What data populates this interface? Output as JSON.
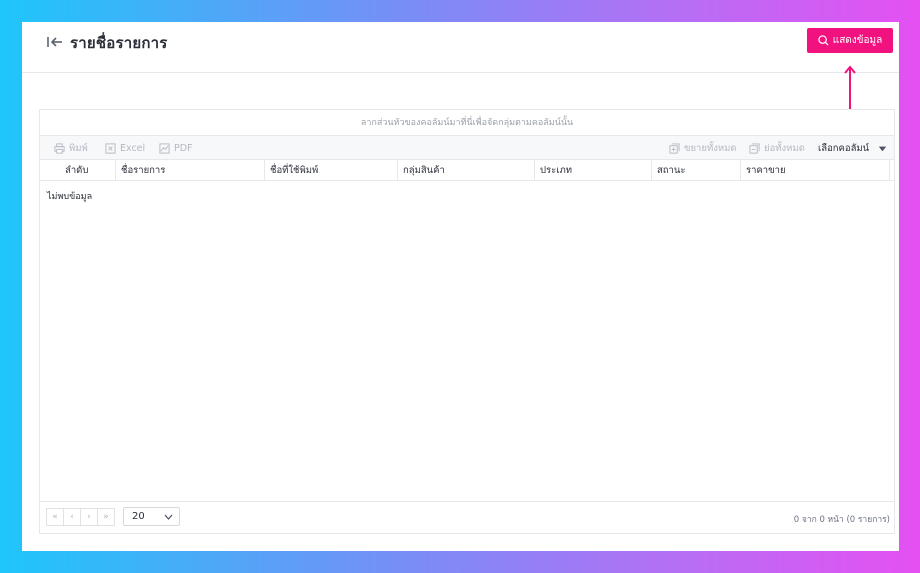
{
  "header": {
    "title": "รายชื่อรายการ",
    "show_button_label": "แสดงข้อมูล",
    "icons": {
      "back": "collapse-left-icon",
      "search": "search-icon"
    }
  },
  "annotation": {
    "color": "#f2127f",
    "icon": "arrow-up-icon"
  },
  "grid": {
    "group_panel_text": "ลากส่วนหัวของคอลัมน์มาที่นี่เพื่อจัดกลุ่มตามคอลัมน์นั้น",
    "toolbar": {
      "print": "พิมพ์",
      "excel": "Excel",
      "pdf": "PDF",
      "expand_all": "ขยายทั้งหมด",
      "collapse_all": "ย่อทั้งหมด",
      "column_chooser": "เลือกคอลัมน์"
    },
    "columns": [
      "ลำดับ",
      "ชื่อรายการ",
      "ชื่อที่ใช้พิมพ์",
      "กลุ่มสินค้า",
      "ประเภท",
      "สถานะ",
      "ราคาขาย"
    ],
    "empty_text": "ไม่พบข้อมูล",
    "pager": {
      "first": "«",
      "prev": "‹",
      "next": "›",
      "last": "»",
      "page_size": "20",
      "info": "0 จาก 0 หน้า (0 รายการ)"
    }
  },
  "colors": {
    "accent": "#f2127f",
    "border": "#e6e8ec"
  }
}
